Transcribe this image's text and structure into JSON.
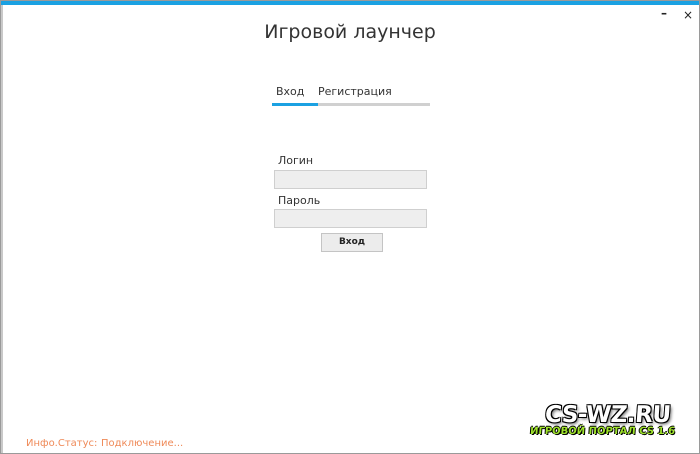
{
  "window": {
    "minimize_label": "–",
    "close_label": "×"
  },
  "header": {
    "title": "Игровой лаунчер"
  },
  "tabs": [
    {
      "label": "Вход",
      "active": true
    },
    {
      "label": "Регистрация",
      "active": false
    }
  ],
  "form": {
    "login_label": "Логин",
    "login_value": "",
    "password_label": "Пароль",
    "password_value": "",
    "submit_label": "Вход"
  },
  "status": {
    "label": "Инфо.Статус:",
    "value": "Подключение..."
  },
  "watermark": {
    "main": "CS-WZ.RU",
    "sub": "ИГРОВОЙ ПОРТАЛ CS 1.6"
  },
  "colors": {
    "accent": "#1ba1e2",
    "status_text": "#ef8a58",
    "watermark_green": "#9ee22b"
  }
}
